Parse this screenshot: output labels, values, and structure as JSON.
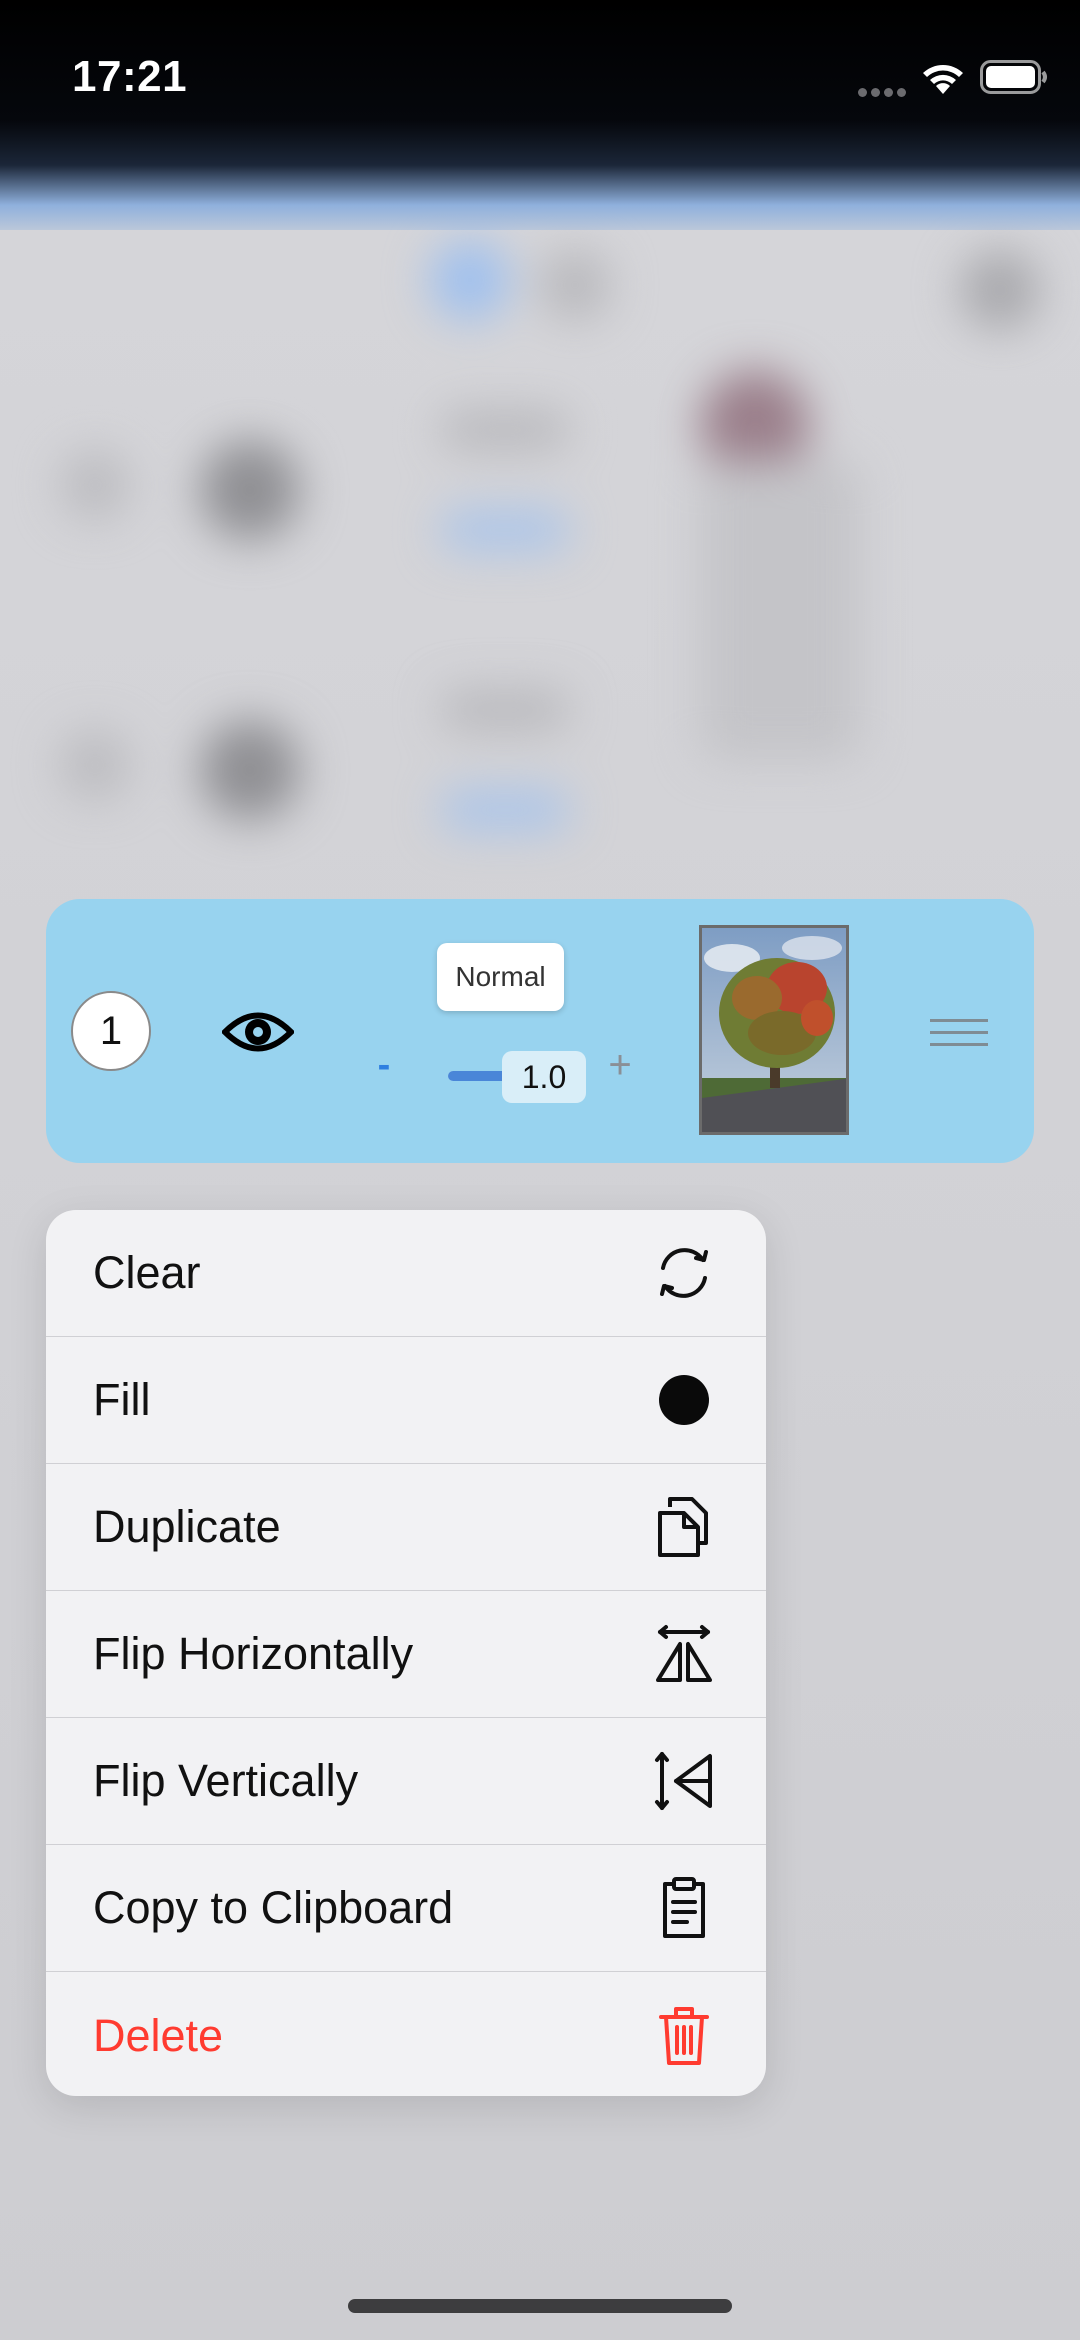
{
  "status_bar": {
    "time": "17:21",
    "icons": [
      "signal-icon",
      "wifi-icon",
      "battery-icon"
    ]
  },
  "layer": {
    "number": "1",
    "visibility_icon": "eye-icon",
    "blend_mode": "Normal",
    "opacity_minus": "-",
    "opacity_value": "1.0",
    "opacity_fraction": 1.0,
    "opacity_plus": "+",
    "thumbnail": "autumn-tree-photo",
    "drag_icon": "drag-handle-icon",
    "background_color": "#98d3ef"
  },
  "context_menu": {
    "items": [
      {
        "label": "Clear",
        "icon": "clear-cycle-icon"
      },
      {
        "label": "Fill",
        "icon": "fill-circle-icon"
      },
      {
        "label": "Duplicate",
        "icon": "duplicate-icon"
      },
      {
        "label": "Flip Horizontally",
        "icon": "flip-horizontal-icon"
      },
      {
        "label": "Flip Vertically",
        "icon": "flip-vertical-icon"
      },
      {
        "label": "Copy to Clipboard",
        "icon": "clipboard-icon"
      },
      {
        "label": "Delete",
        "icon": "trash-icon",
        "destructive": true
      }
    ],
    "destructive_color": "#ff3b30"
  }
}
